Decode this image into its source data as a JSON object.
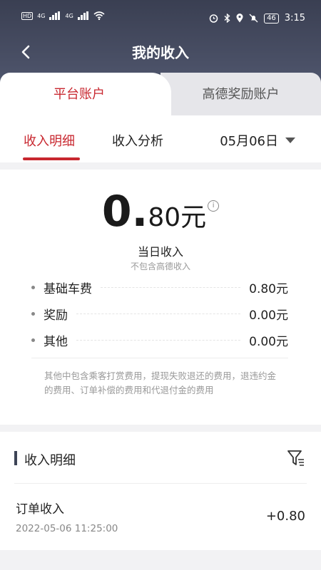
{
  "statusbar": {
    "left_badges": [
      "HD",
      "HD"
    ],
    "network": [
      "4G",
      "4G"
    ],
    "battery": "46",
    "time": "3:15"
  },
  "header": {
    "title": "我的收入"
  },
  "tabs": {
    "active": "平台账户",
    "inactive": "高德奖励账户"
  },
  "subnav": {
    "tab1": "收入明细",
    "tab2": "收入分析",
    "date": "05月06日"
  },
  "summary": {
    "amount_int": "0.",
    "amount_dec": "80元",
    "info_glyph": "i",
    "label": "当日收入",
    "sublabel": "不包含高德收入",
    "rows": [
      {
        "label": "基础车费",
        "value": "0.80元"
      },
      {
        "label": "奖励",
        "value": "0.00元"
      },
      {
        "label": "其他",
        "value": "0.00元"
      }
    ],
    "note": "其他中包含乘客打赏费用，提现失败退还的费用，退违约金的费用、订单补偿的费用和代退付金的费用"
  },
  "details": {
    "title": "收入明细",
    "items": [
      {
        "title": "订单收入",
        "time": "2022-05-06 11:25:00",
        "amount": "+0.80"
      }
    ]
  },
  "colors": {
    "accent": "#c8272f",
    "header": "#3a3f52"
  },
  "icons": [
    "back-arrow-icon",
    "info-icon",
    "filter-icon",
    "dropdown-triangle-icon",
    "wifi-icon",
    "alarm-icon",
    "bluetooth-icon",
    "location-icon",
    "mute-icon"
  ]
}
